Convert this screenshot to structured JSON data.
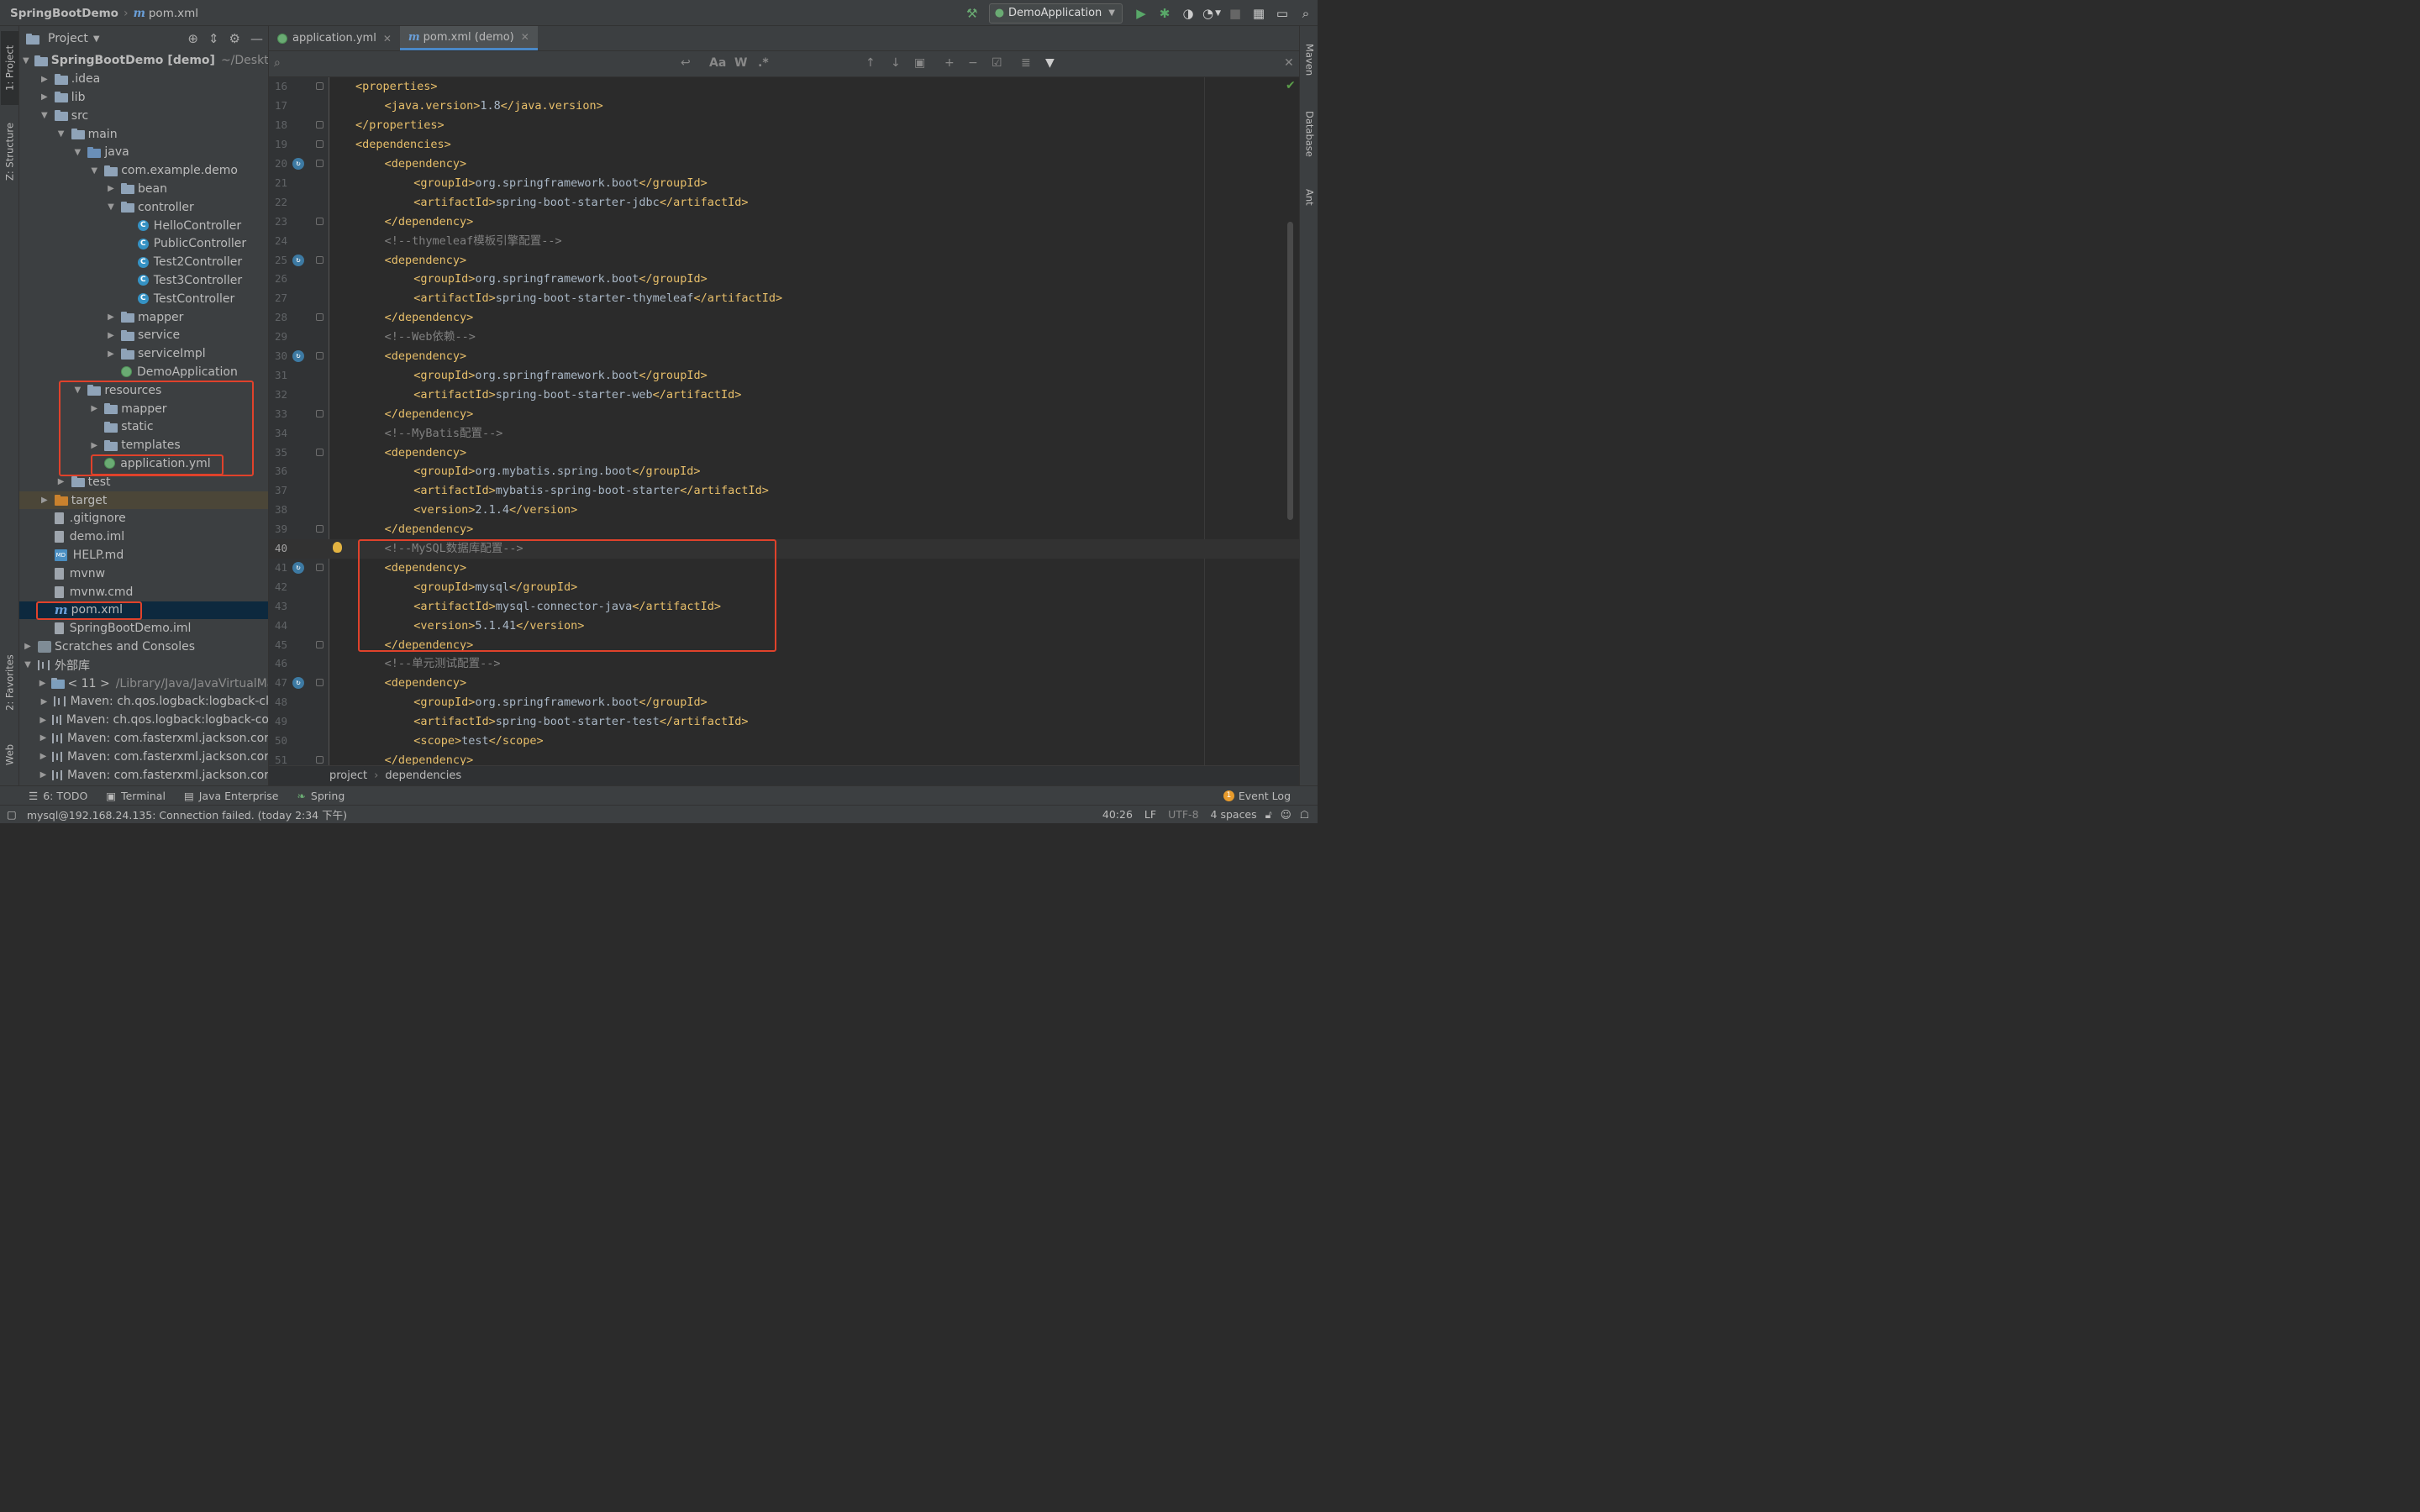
{
  "titlebar": {
    "project_name": "SpringBootDemo",
    "file_name": "pom.xml",
    "run_config": "DemoApplication"
  },
  "left_strip": {
    "project_tab": "1: Project",
    "structure_tab": "Z: Structure",
    "favorites_tab": "2: Favorites",
    "web_tab": "Web"
  },
  "right_strip": {
    "maven_tab": "Maven",
    "database_tab": "Database",
    "ant_tab": "Ant"
  },
  "project_panel": {
    "title": "Project",
    "tree": [
      {
        "label": "SpringBootDemo",
        "suffix": "[demo]",
        "path": "~/Desktop/",
        "depth": 0,
        "icon": "folder",
        "arrow": "open"
      },
      {
        "label": ".idea",
        "depth": 1,
        "icon": "folder",
        "arrow": "closed"
      },
      {
        "label": "lib",
        "depth": 1,
        "icon": "folder",
        "arrow": "closed"
      },
      {
        "label": "src",
        "depth": 1,
        "icon": "folder",
        "arrow": "open"
      },
      {
        "label": "main",
        "depth": 2,
        "icon": "folder",
        "arrow": "open"
      },
      {
        "label": "java",
        "depth": 3,
        "icon": "folder-src",
        "arrow": "open"
      },
      {
        "label": "com.example.demo",
        "depth": 4,
        "icon": "folder",
        "arrow": "open"
      },
      {
        "label": "bean",
        "depth": 5,
        "icon": "folder",
        "arrow": "closed"
      },
      {
        "label": "controller",
        "depth": 5,
        "icon": "folder",
        "arrow": "open"
      },
      {
        "label": "HelloController",
        "depth": 6,
        "icon": "class",
        "arrow": "none"
      },
      {
        "label": "PublicController",
        "depth": 6,
        "icon": "class",
        "arrow": "none"
      },
      {
        "label": "Test2Controller",
        "depth": 6,
        "icon": "class",
        "arrow": "none"
      },
      {
        "label": "Test3Controller",
        "depth": 6,
        "icon": "class",
        "arrow": "none"
      },
      {
        "label": "TestController",
        "depth": 6,
        "icon": "class",
        "arrow": "none"
      },
      {
        "label": "mapper",
        "depth": 5,
        "icon": "folder",
        "arrow": "closed"
      },
      {
        "label": "service",
        "depth": 5,
        "icon": "folder",
        "arrow": "closed"
      },
      {
        "label": "serviceImpl",
        "depth": 5,
        "icon": "folder",
        "arrow": "closed"
      },
      {
        "label": "DemoApplication",
        "depth": 5,
        "icon": "spring",
        "arrow": "none"
      },
      {
        "label": "resources",
        "depth": 3,
        "icon": "folder-res",
        "arrow": "open"
      },
      {
        "label": "mapper",
        "depth": 4,
        "icon": "folder",
        "arrow": "closed"
      },
      {
        "label": "static",
        "depth": 4,
        "icon": "folder",
        "arrow": "none"
      },
      {
        "label": "templates",
        "depth": 4,
        "icon": "folder",
        "arrow": "closed"
      },
      {
        "label": "application.yml",
        "depth": 4,
        "icon": "spring",
        "arrow": "none"
      },
      {
        "label": "test",
        "depth": 2,
        "icon": "folder",
        "arrow": "closed"
      },
      {
        "label": "target",
        "depth": 1,
        "icon": "folder-orange",
        "arrow": "closed",
        "excluded": true
      },
      {
        "label": ".gitignore",
        "depth": 1,
        "icon": "file",
        "arrow": "none"
      },
      {
        "label": "demo.iml",
        "depth": 1,
        "icon": "file",
        "arrow": "none"
      },
      {
        "label": "HELP.md",
        "depth": 1,
        "icon": "md",
        "arrow": "none"
      },
      {
        "label": "mvnw",
        "depth": 1,
        "icon": "file",
        "arrow": "none"
      },
      {
        "label": "mvnw.cmd",
        "depth": 1,
        "icon": "file",
        "arrow": "none"
      },
      {
        "label": "pom.xml",
        "depth": 1,
        "icon": "maven",
        "arrow": "none",
        "selected": true
      },
      {
        "label": "SpringBootDemo.iml",
        "depth": 1,
        "icon": "file",
        "arrow": "none"
      },
      {
        "label": "Scratches and Consoles",
        "depth": 0,
        "icon": "scratch",
        "arrow": "closed"
      },
      {
        "label": "外部库",
        "depth": 0,
        "icon": "lib",
        "arrow": "open"
      },
      {
        "label": "< 11 >",
        "path": "/Library/Java/JavaVirtualMa",
        "depth": 1,
        "icon": "jdk",
        "arrow": "closed"
      },
      {
        "label": "Maven: ch.qos.logback:logback-cl",
        "depth": 1,
        "icon": "lib",
        "arrow": "closed"
      },
      {
        "label": "Maven: ch.qos.logback:logback-co",
        "depth": 1,
        "icon": "lib",
        "arrow": "closed"
      },
      {
        "label": "Maven: com.fasterxml.jackson.cor",
        "depth": 1,
        "icon": "lib",
        "arrow": "closed"
      },
      {
        "label": "Maven: com.fasterxml.jackson.cor",
        "depth": 1,
        "icon": "lib",
        "arrow": "closed"
      },
      {
        "label": "Maven: com.fasterxml.jackson.cor",
        "depth": 1,
        "icon": "lib",
        "arrow": "closed"
      }
    ]
  },
  "editor": {
    "tabs": [
      {
        "label": "application.yml",
        "icon": "spring",
        "active": false
      },
      {
        "label": "pom.xml (demo)",
        "icon": "maven",
        "active": true
      }
    ],
    "find": {
      "case_label": "Aa",
      "word_label": "W",
      "regex_label": ".*"
    },
    "lines": [
      {
        "n": "16",
        "indent": 0,
        "kind": "tag",
        "text": "<properties>",
        "fold": true
      },
      {
        "n": "17",
        "indent": 1,
        "kind": "mixed",
        "open": "<java.version>",
        "value": "1.8",
        "close": "</java.version>"
      },
      {
        "n": "18",
        "indent": 0,
        "kind": "tag",
        "text": "</properties>",
        "fold": true
      },
      {
        "n": "19",
        "indent": 0,
        "kind": "tag",
        "text": "<dependencies>",
        "fold": true
      },
      {
        "n": "20",
        "indent": 1,
        "kind": "tag",
        "text": "<dependency>",
        "fold": true,
        "gicon": true
      },
      {
        "n": "21",
        "indent": 2,
        "kind": "mixed",
        "open": "<groupId>",
        "value": "org.springframework.boot",
        "close": "</groupId>"
      },
      {
        "n": "22",
        "indent": 2,
        "kind": "mixed",
        "open": "<artifactId>",
        "value": "spring-boot-starter-jdbc",
        "close": "</artifactId>"
      },
      {
        "n": "23",
        "indent": 1,
        "kind": "tag",
        "text": "</dependency>",
        "fold": true
      },
      {
        "n": "24",
        "indent": 1,
        "kind": "comment",
        "text": "<!--thymeleaf模板引擎配置-->"
      },
      {
        "n": "25",
        "indent": 1,
        "kind": "tag",
        "text": "<dependency>",
        "fold": true,
        "gicon": true
      },
      {
        "n": "26",
        "indent": 2,
        "kind": "mixed",
        "open": "<groupId>",
        "value": "org.springframework.boot",
        "close": "</groupId>"
      },
      {
        "n": "27",
        "indent": 2,
        "kind": "mixed",
        "open": "<artifactId>",
        "value": "spring-boot-starter-thymeleaf",
        "close": "</artifactId>"
      },
      {
        "n": "28",
        "indent": 1,
        "kind": "tag",
        "text": "</dependency>",
        "fold": true
      },
      {
        "n": "29",
        "indent": 1,
        "kind": "comment",
        "text": "<!--Web依赖-->"
      },
      {
        "n": "30",
        "indent": 1,
        "kind": "tag",
        "text": "<dependency>",
        "fold": true,
        "gicon": true
      },
      {
        "n": "31",
        "indent": 2,
        "kind": "mixed",
        "open": "<groupId>",
        "value": "org.springframework.boot",
        "close": "</groupId>"
      },
      {
        "n": "32",
        "indent": 2,
        "kind": "mixed",
        "open": "<artifactId>",
        "value": "spring-boot-starter-web",
        "close": "</artifactId>"
      },
      {
        "n": "33",
        "indent": 1,
        "kind": "tag",
        "text": "</dependency>",
        "fold": true
      },
      {
        "n": "34",
        "indent": 1,
        "kind": "comment",
        "text": "<!--MyBatis配置-->"
      },
      {
        "n": "35",
        "indent": 1,
        "kind": "tag",
        "text": "<dependency>",
        "fold": true
      },
      {
        "n": "36",
        "indent": 2,
        "kind": "mixed",
        "open": "<groupId>",
        "value": "org.mybatis.spring.boot",
        "close": "</groupId>"
      },
      {
        "n": "37",
        "indent": 2,
        "kind": "mixed",
        "open": "<artifactId>",
        "value": "mybatis-spring-boot-starter",
        "close": "</artifactId>"
      },
      {
        "n": "38",
        "indent": 2,
        "kind": "mixed",
        "open": "<version>",
        "value": "2.1.4",
        "close": "</version>"
      },
      {
        "n": "39",
        "indent": 1,
        "kind": "tag",
        "text": "</dependency>",
        "fold": true
      },
      {
        "n": "40",
        "indent": 1,
        "kind": "comment",
        "text": "<!--MySQL数据库配置-->",
        "current": true,
        "bulb": true
      },
      {
        "n": "41",
        "indent": 1,
        "kind": "tag",
        "text": "<dependency>",
        "fold": true,
        "gicon": true
      },
      {
        "n": "42",
        "indent": 2,
        "kind": "mixed",
        "open": "<groupId>",
        "value": "mysql",
        "close": "</groupId>"
      },
      {
        "n": "43",
        "indent": 2,
        "kind": "mixed",
        "open": "<artifactId>",
        "value": "mysql-connector-java",
        "close": "</artifactId>"
      },
      {
        "n": "44",
        "indent": 2,
        "kind": "mixed",
        "open": "<version>",
        "value": "5.1.41",
        "close": "</version>"
      },
      {
        "n": "45",
        "indent": 1,
        "kind": "tag",
        "text": "</dependency>",
        "fold": true
      },
      {
        "n": "46",
        "indent": 1,
        "kind": "comment",
        "text": "<!--单元测试配置-->"
      },
      {
        "n": "47",
        "indent": 1,
        "kind": "tag",
        "text": "<dependency>",
        "fold": true,
        "gicon": true
      },
      {
        "n": "48",
        "indent": 2,
        "kind": "mixed",
        "open": "<groupId>",
        "value": "org.springframework.boot",
        "close": "</groupId>"
      },
      {
        "n": "49",
        "indent": 2,
        "kind": "mixed",
        "open": "<artifactId>",
        "value": "spring-boot-starter-test",
        "close": "</artifactId>"
      },
      {
        "n": "50",
        "indent": 2,
        "kind": "mixed",
        "open": "<scope>",
        "value": "test",
        "close": "</scope>"
      },
      {
        "n": "51",
        "indent": 1,
        "kind": "tag",
        "text": "</dependency>",
        "fold": true
      }
    ],
    "breadcrumb": [
      "project",
      "dependencies"
    ]
  },
  "tool_tabs": {
    "todo": "6: TODO",
    "terminal": "Terminal",
    "java_enterprise": "Java Enterprise",
    "spring": "Spring",
    "event_log": "Event Log",
    "event_count": "1"
  },
  "status": {
    "message": "mysql@192.168.24.135: Connection failed. (today 2:34 下午)",
    "position": "40:26",
    "line_sep": "LF",
    "encoding": "UTF-8",
    "indent": "4 spaces"
  },
  "colors": {
    "accent": "#4a88c7",
    "highlight_box": "#e0422b",
    "tag": "#e8bf6a",
    "comment": "#808080"
  }
}
